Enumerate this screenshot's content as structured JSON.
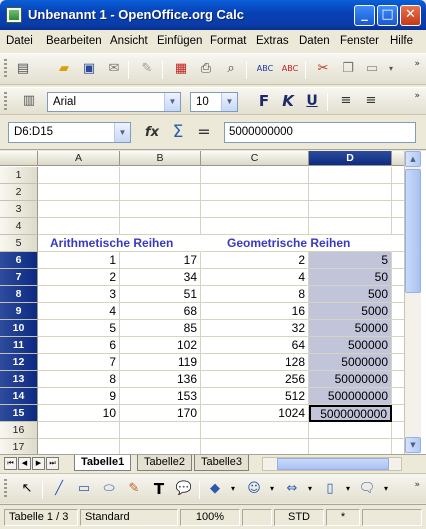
{
  "window": {
    "title": "Unbenannt 1 - OpenOffice.org Calc",
    "minimize_glyph": "_",
    "maximize_glyph": "□",
    "close_glyph": "✕"
  },
  "menu": [
    "Datei",
    "Bearbeiten",
    "Ansicht",
    "Einfügen",
    "Format",
    "Extras",
    "Daten",
    "Fenster",
    "Hilfe"
  ],
  "toolbar": {
    "font_name": "Arial",
    "font_size": "10",
    "bold_label": "F",
    "italic_label": "K",
    "underline_label": "U",
    "overflow_glyph": "»"
  },
  "formula_bar": {
    "name_box": "D6:D15",
    "function_wizard_label": "fx",
    "sum_label": "Σ",
    "equals_label": "=",
    "content": "5000000000"
  },
  "sheet": {
    "columns": [
      "A",
      "B",
      "C",
      "D"
    ],
    "selected_column": "D",
    "rows": [
      1,
      2,
      3,
      4,
      5,
      6,
      7,
      8,
      9,
      10,
      11,
      12,
      13,
      14,
      15,
      16,
      17
    ],
    "headings": {
      "arithmetic": "Arithmetische Reihen",
      "geometric": "Geometrische Reihen"
    },
    "data": [
      {
        "a": "1",
        "b": "17",
        "c": "2",
        "d": "5"
      },
      {
        "a": "2",
        "b": "34",
        "c": "4",
        "d": "50"
      },
      {
        "a": "3",
        "b": "51",
        "c": "8",
        "d": "500"
      },
      {
        "a": "4",
        "b": "68",
        "c": "16",
        "d": "5000"
      },
      {
        "a": "5",
        "b": "85",
        "c": "32",
        "d": "50000"
      },
      {
        "a": "6",
        "b": "102",
        "c": "64",
        "d": "500000"
      },
      {
        "a": "7",
        "b": "119",
        "c": "128",
        "d": "5000000"
      },
      {
        "a": "8",
        "b": "136",
        "c": "256",
        "d": "50000000"
      },
      {
        "a": "9",
        "b": "153",
        "c": "512",
        "d": "500000000"
      },
      {
        "a": "10",
        "b": "170",
        "c": "1024",
        "d": "5000000000"
      }
    ]
  },
  "tabs": {
    "sheets": [
      "Tabelle1",
      "Tabelle2",
      "Tabelle3"
    ],
    "active": "Tabelle1"
  },
  "status": {
    "page": "Tabelle 1 / 3",
    "style": "Standard",
    "zoom": "100%",
    "mode": "STD",
    "modified": "*"
  },
  "colors": {
    "selection": "#c2c5d9",
    "heading_text": "#3a3ac0",
    "header_selected": "#0c2a82"
  }
}
